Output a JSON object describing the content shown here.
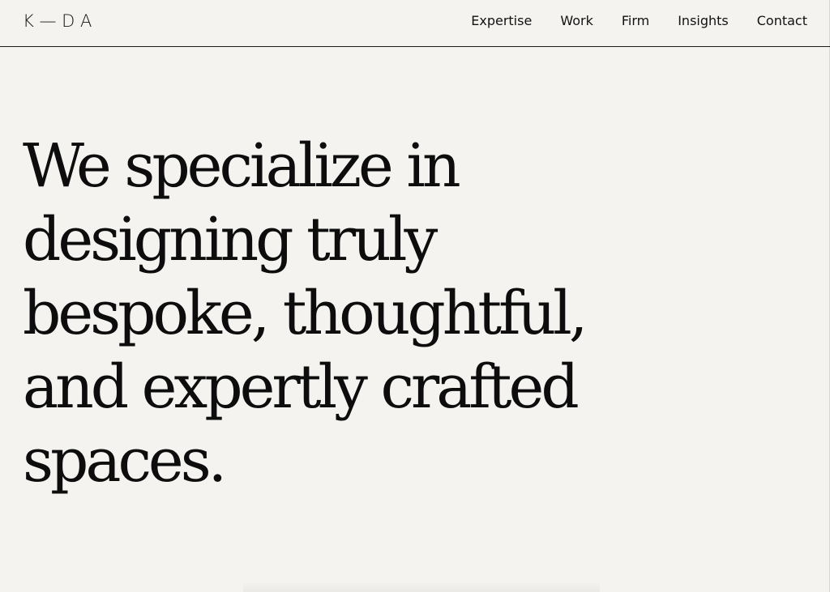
{
  "header": {
    "logo": "K — D A",
    "nav": [
      {
        "label": "Expertise"
      },
      {
        "label": "Work"
      },
      {
        "label": "Firm"
      },
      {
        "label": "Insights"
      },
      {
        "label": "Contact"
      }
    ]
  },
  "hero": {
    "lines": [
      "We specialize in",
      "designing truly",
      "bespoke, thoughtful,",
      "and expertly crafted",
      "spaces."
    ]
  },
  "colors": {
    "background": "#f4f3f0",
    "text": "#111111",
    "divider": "#1a1a1a"
  }
}
